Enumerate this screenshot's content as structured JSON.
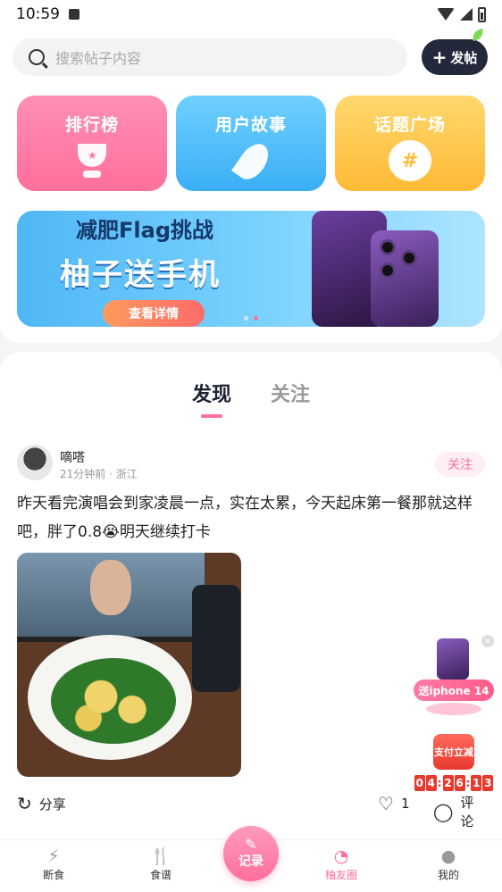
{
  "status": {
    "time": "10:59"
  },
  "search": {
    "placeholder": "搜索帖子内容"
  },
  "post_button": {
    "label": "发帖"
  },
  "cards": [
    {
      "title": "排行榜",
      "icon": "trophy-icon"
    },
    {
      "title": "用户故事",
      "icon": "feather-icon"
    },
    {
      "title": "话题广场",
      "icon": "hashtag-icon"
    }
  ],
  "banner": {
    "line1": "减肥Flag挑战",
    "line2": "柚子送手机",
    "cta": "查看详情"
  },
  "tabs": [
    {
      "label": "发现",
      "active": true
    },
    {
      "label": "关注",
      "active": false
    }
  ],
  "post": {
    "username": "嘀嗒",
    "time": "21分钟前",
    "location": "浙江",
    "meta": "21分钟前 · 浙江",
    "follow_label": "关注",
    "text": "昨天看完演唱会到家凌晨一点，实在太累，今天起床第一餐那就这样吧，胖了0.8😭明天继续打卡",
    "share_label": "分享",
    "like_count": "1",
    "comment_label": "评论"
  },
  "promo": {
    "label": "送iphone 14"
  },
  "pay": {
    "label": "支付立减",
    "countdown": [
      "0",
      "4",
      "2",
      "6",
      "1",
      "3"
    ]
  },
  "nav": [
    {
      "label": "断食",
      "icon": "lightning-icon"
    },
    {
      "label": "食谱",
      "icon": "fork-knife-icon"
    },
    {
      "label": "记录",
      "icon": "pen-icon"
    },
    {
      "label": "柚友圈",
      "icon": "circle-icon",
      "active": true
    },
    {
      "label": "我的",
      "icon": "user-icon"
    }
  ],
  "colors": {
    "accent": "#ff6f9c",
    "dark": "#24283b"
  }
}
